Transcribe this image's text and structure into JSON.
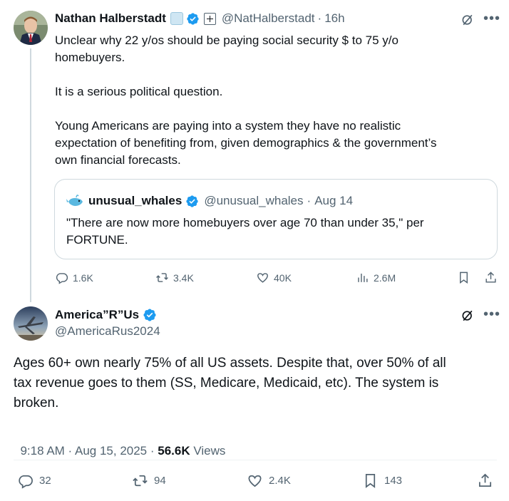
{
  "parent_tweet": {
    "author_name": "Nathan Halberstadt",
    "handle": "@NatHalberstadt",
    "time": "16h",
    "text": "Unclear why 22 y/os should be paying social security $ to 75 y/o\nhomebuyers.\n\nIt is a serious political question.\n\nYoung Americans are paying into a system they have no realistic\nexpectation of benefiting from, given demographics & the government’s\nown financial forecasts.",
    "quote": {
      "author_name": "unusual_whales",
      "handle": "@unusual_whales",
      "time": "Aug 14",
      "text": "\"There are now more homebuyers over age 70 than under 35,\" per\nFORTUNE."
    },
    "actions": {
      "replies": "1.6K",
      "reposts": "3.4K",
      "likes": "40K",
      "views": "2.6M"
    }
  },
  "main_tweet": {
    "author_name": "America”R”Us",
    "handle": "@AmericaRus2024",
    "text": "Ages 60+ own nearly 75% of all US assets. Despite that, over 50% of all\ntax revenue goes to them (SS, Medicare, Medicaid, etc). The system is\nbroken.",
    "timestamp": "9:18 AM · Aug 15, 2025 · ",
    "views_count": "56.6K",
    "views_label": " Views",
    "actions": {
      "replies": "32",
      "reposts": "94",
      "likes": "2.4K",
      "bookmarks": "143"
    }
  },
  "colors": {
    "verified_blue": "#1d9bf0",
    "muted": "#536471",
    "border": "#cfd9de"
  }
}
